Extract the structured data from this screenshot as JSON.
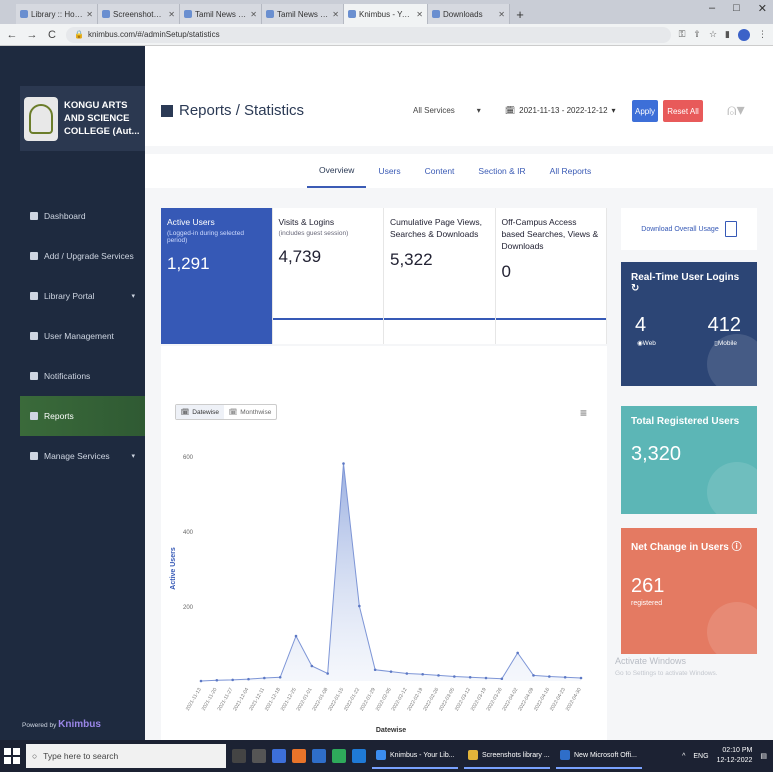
{
  "browser": {
    "tabs": [
      {
        "label": "Library :: Home Page",
        "active": false
      },
      {
        "label": "Screenshots - img",
        "active": false
      },
      {
        "label": "Tamil News Latest",
        "active": false
      },
      {
        "label": "Tamil News | Online",
        "active": false
      },
      {
        "label": "Knimbus - Your Libra",
        "active": true
      },
      {
        "label": "Downloads",
        "active": false
      }
    ],
    "url": "knimbus.com/#/adminSetup/statistics"
  },
  "sidebar": {
    "college_name": [
      "KONGU ARTS",
      "AND SCIENCE",
      "COLLEGE (Aut..."
    ],
    "items": [
      {
        "label": "Dashboard",
        "icon": "dashboard-icon",
        "caret": false,
        "active": false
      },
      {
        "label": "Add / Upgrade Services",
        "icon": "wifi-icon",
        "caret": false,
        "active": false
      },
      {
        "label": "Library Portal",
        "icon": "portal-icon",
        "caret": true,
        "active": false
      },
      {
        "label": "User Management",
        "icon": "user-icon",
        "caret": false,
        "active": false
      },
      {
        "label": "Notifications",
        "icon": "bell-icon",
        "caret": false,
        "active": false
      },
      {
        "label": "Reports",
        "icon": "chart-icon",
        "caret": false,
        "active": true
      },
      {
        "label": "Manage Services",
        "icon": "wifi-icon",
        "caret": true,
        "active": false
      }
    ],
    "powered_by": "Powered by",
    "brand": "Knimbus"
  },
  "header": {
    "title": "Reports / Statistics",
    "service_filter": "All Services",
    "date_range": "2021-11-13 - 2022-12-12",
    "apply_label": "Apply",
    "reset_label": "Reset All"
  },
  "tabs": [
    "Overview",
    "Users",
    "Content",
    "Section & IR",
    "All Reports"
  ],
  "stats": [
    {
      "title": "Active Users",
      "sub": "(Logged-in during selected period)",
      "value": "1,291"
    },
    {
      "title": "Visits & Logins",
      "sub": "(includes guest session)",
      "value": "4,739"
    },
    {
      "title": "Cumulative Page Views, Searches & Downloads",
      "sub": "",
      "value": "5,322"
    },
    {
      "title": "Off-Campus Access based Searches, Views & Downloads",
      "sub": "",
      "value": "0"
    }
  ],
  "chart_controls": {
    "datewise": "Datewise",
    "monthwise": "Monthwise"
  },
  "chart_data": {
    "type": "area",
    "ylabel": "Active Users",
    "xlabel": "Datewise",
    "ylim": [
      0,
      600
    ],
    "yticks": [
      200,
      400,
      600
    ],
    "x": [
      "2021-11-13",
      "2021-11-20",
      "2021-11-27",
      "2021-12-04",
      "2021-12-11",
      "2021-12-18",
      "2021-12-25",
      "2022-01-01",
      "2022-01-08",
      "2022-01-15",
      "2022-01-22",
      "2022-01-29",
      "2022-02-05",
      "2022-02-12",
      "2022-02-19",
      "2022-02-26",
      "2022-03-05",
      "2022-03-12",
      "2022-03-19",
      "2022-03-26",
      "2022-04-02",
      "2022-04-09",
      "2022-04-16",
      "2022-04-23",
      "2022-04-30"
    ],
    "values": [
      0,
      2,
      3,
      5,
      8,
      10,
      120,
      40,
      20,
      580,
      200,
      30,
      25,
      20,
      18,
      15,
      12,
      10,
      8,
      6,
      75,
      15,
      12,
      10,
      8
    ]
  },
  "right": {
    "download_label": "Download Overall Usage",
    "realtime_title": "Real-Time User Logins",
    "web_value": "4",
    "web_label": "Web",
    "mobile_value": "412",
    "mobile_label": "Mobile",
    "registered_title": "Total Registered Users",
    "registered_value": "3,320",
    "netchange_title": "Net Change in Users",
    "netchange_value": "261",
    "netchange_sub": "registered",
    "watermark": "Activate Windows",
    "watermark_sub": "Go to Settings to activate Windows."
  },
  "taskbar": {
    "search_placeholder": "Type here to search",
    "apps": [
      "Knimbus - Your Lib...",
      "Screenshots library ...",
      "New Microsoft Offi..."
    ],
    "time": "02:10 PM",
    "date": "12-12-2022",
    "lang": "ENG"
  }
}
